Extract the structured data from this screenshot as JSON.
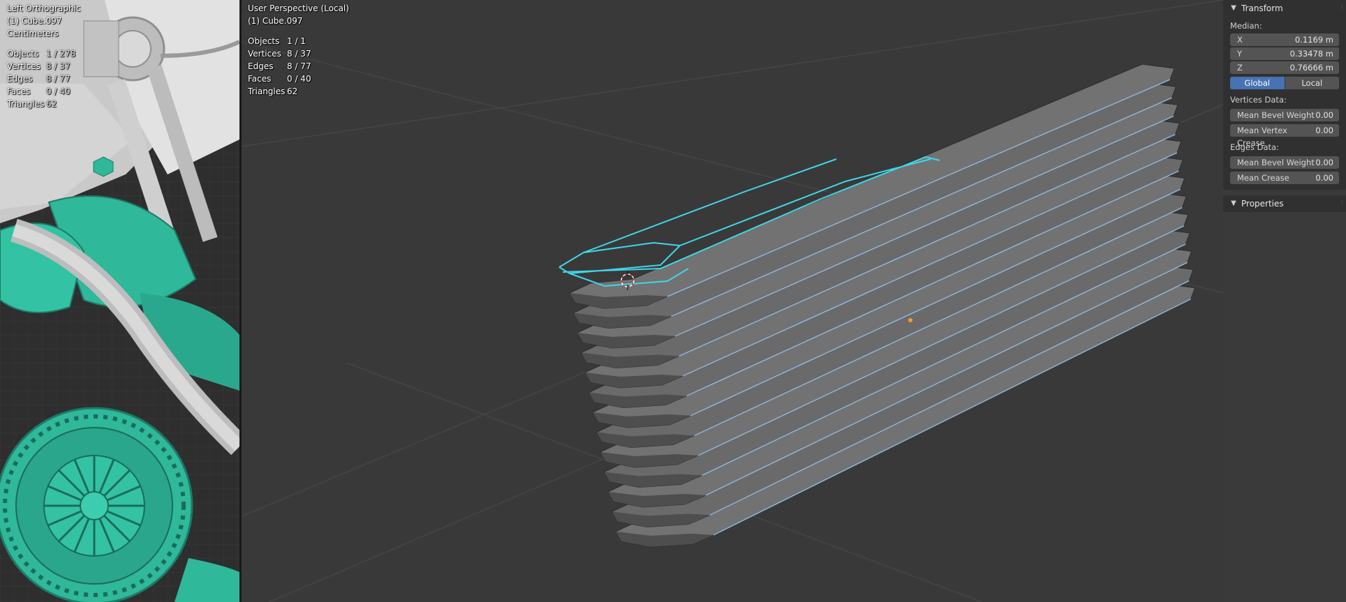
{
  "left_viewport": {
    "view_name": "Left Orthographic",
    "object_name": "(1) Cube.097",
    "units": "Centimeters",
    "stats": [
      {
        "label": "Objects",
        "value": "1 / 278"
      },
      {
        "label": "Vertices",
        "value": "8 / 37"
      },
      {
        "label": "Edges",
        "value": "8 / 77"
      },
      {
        "label": "Faces",
        "value": "0 / 40"
      },
      {
        "label": "Triangles",
        "value": "62"
      }
    ]
  },
  "main_viewport": {
    "view_name": "User Perspective (Local)",
    "object_name": "(1) Cube.097",
    "stats": [
      {
        "label": "Objects",
        "value": "1 / 1"
      },
      {
        "label": "Vertices",
        "value": "8 / 37"
      },
      {
        "label": "Edges",
        "value": "8 / 77"
      },
      {
        "label": "Faces",
        "value": "0 / 40"
      },
      {
        "label": "Triangles",
        "value": "62"
      }
    ]
  },
  "n_panel": {
    "transform": {
      "title": "Transform",
      "median_label": "Median:",
      "x_label": "X",
      "x_value": "0.1169 m",
      "y_label": "Y",
      "y_value": "0.33478 m",
      "z_label": "Z",
      "z_value": "0.76666 m",
      "global_label": "Global",
      "local_label": "Local",
      "vertices_data_label": "Vertices Data:",
      "mean_bevel_weight_label": "Mean Bevel Weight",
      "mean_bevel_weight_value": "0.00",
      "mean_vertex_crease_label": "Mean Vertex Crease",
      "mean_vertex_crease_value": "0.00",
      "edges_data_label": "Edges Data:",
      "edge_bevel_weight_label": "Mean Bevel Weight",
      "edge_bevel_weight_value": "0.00",
      "mean_crease_label": "Mean Crease",
      "mean_crease_value": "0.00"
    },
    "properties": {
      "title": "Properties"
    }
  },
  "colors": {
    "accent": "#4772b3",
    "selection": "#3fd7e8",
    "teal_part": "#2fb89a"
  }
}
